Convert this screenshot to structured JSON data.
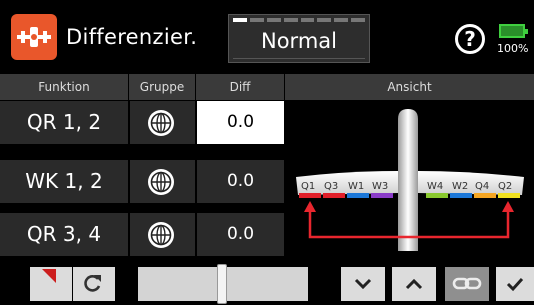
{
  "header": {
    "title": "Differenzier.",
    "flight_mode": "Normal",
    "help_label": "?",
    "battery_percent": "100%",
    "icons": {
      "app": "servo-icon",
      "help": "help-icon",
      "battery": "battery-icon"
    }
  },
  "table": {
    "columns": [
      "Funktion",
      "Gruppe",
      "Diff",
      "Ansicht"
    ],
    "rows": [
      {
        "funktion": "QR 1, 2",
        "gruppe": "globe-icon",
        "diff": "0.0",
        "selected": true
      },
      {
        "funktion": "WK 1, 2",
        "gruppe": "globe-icon",
        "diff": "0.0",
        "selected": false
      },
      {
        "funktion": "QR 3, 4",
        "gruppe": "globe-icon",
        "diff": "0.0",
        "selected": false
      }
    ]
  },
  "preview": {
    "left_labels": [
      "Q1",
      "Q3",
      "W1",
      "W3"
    ],
    "right_labels": [
      "W4",
      "W2",
      "Q4",
      "Q2"
    ],
    "left_colors": [
      "#e0202a",
      "#e0202a",
      "#1d78d8",
      "#8a3cc8"
    ],
    "right_colors": [
      "#8ac92e",
      "#1d78d8",
      "#f5a623",
      "#f0e020"
    ],
    "link_color": "#e8262e"
  },
  "toolbar": {
    "icons": [
      "back-icon",
      "reset-icon",
      "value-slider",
      "chevron-down-icon",
      "chevron-up-icon",
      "link-icon",
      "check-icon"
    ],
    "slider_value": 0.5
  },
  "colors": {
    "accent": "#e9572b",
    "battery": "#3fcf3f"
  }
}
